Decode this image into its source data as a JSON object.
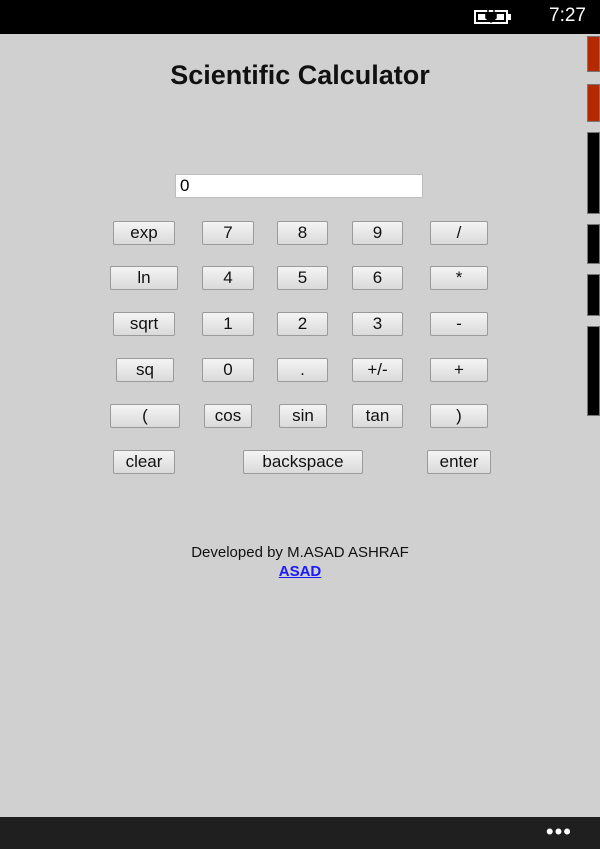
{
  "status": {
    "time": "7:27"
  },
  "app": {
    "title": "Scientific Calculator"
  },
  "display": {
    "value": "0"
  },
  "keys": {
    "exp": "exp",
    "k7": "7",
    "k8": "8",
    "k9": "9",
    "div": "/",
    "ln": "ln",
    "k4": "4",
    "k5": "5",
    "k6": "6",
    "mul": "*",
    "sqrt": "sqrt",
    "k1": "1",
    "k2": "2",
    "k3": "3",
    "sub": "-",
    "sq": "sq",
    "k0": "0",
    "dot": ".",
    "neg": "+/-",
    "add": "+",
    "lparen": "(",
    "cos": "cos",
    "sin": "sin",
    "tan": "tan",
    "rparen": ")",
    "clear": "clear",
    "backspace": "backspace",
    "enter": "enter"
  },
  "footer": {
    "developed_by": "Developed by M.ASAD ASHRAF",
    "link": "ASAD"
  },
  "app_bar": {
    "more": "•••"
  },
  "colors": {
    "background": "#d0d0d0",
    "status_bar": "#000000",
    "link": "#1a1aff",
    "side_red": "#b32a00"
  }
}
